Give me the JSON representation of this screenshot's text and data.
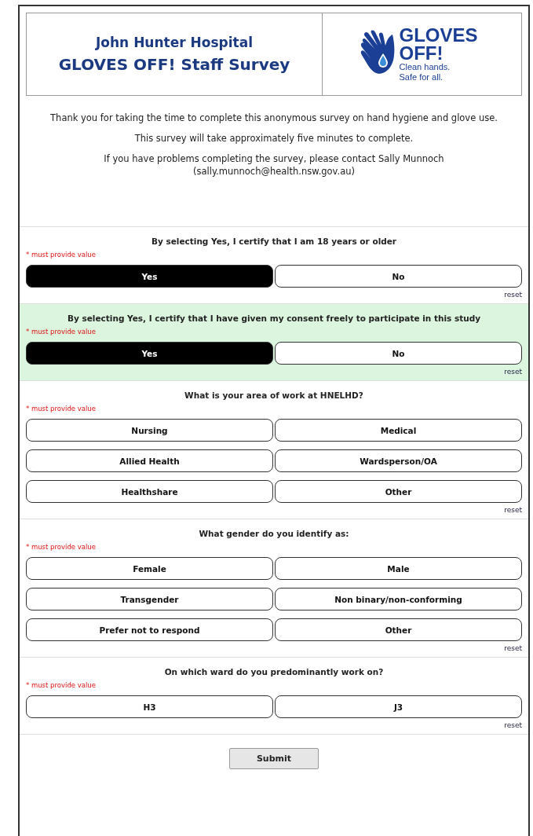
{
  "header": {
    "hospital": "John Hunter Hospital",
    "title": "GLOVES OFF! Staff Survey",
    "logo": {
      "wordmark": "GLOVES OFF!",
      "tagline_1": "Clean hands.",
      "tagline_2": "Safe for all."
    }
  },
  "intro": [
    "Thank you for taking the time to complete this anonymous survey on hand hygiene and glove use.",
    "This survey will take approximately five minutes to complete.",
    "If you have problems completing the survey, please contact Sally Munnoch (sally.munnoch@health.nsw.gov.au)"
  ],
  "questions": [
    {
      "question": "By selecting Yes, I certify that I am 18 years or older",
      "required_note": "* must provide value",
      "highlighted": false,
      "options": [
        {
          "label": "Yes",
          "selected": true
        },
        {
          "label": "No",
          "selected": false
        }
      ],
      "reset": "reset"
    },
    {
      "question": "By selecting Yes, I certify that I have given my consent freely to participate in this study",
      "required_note": "* must provide value",
      "highlighted": true,
      "options": [
        {
          "label": "Yes",
          "selected": true
        },
        {
          "label": "No",
          "selected": false
        }
      ],
      "reset": "reset"
    },
    {
      "question": "What is your area of work at HNELHD?",
      "required_note": "* must provide value",
      "highlighted": false,
      "options": [
        {
          "label": "Nursing",
          "selected": false
        },
        {
          "label": "Medical",
          "selected": false
        },
        {
          "label": "Allied Health",
          "selected": false
        },
        {
          "label": "Wardsperson/OA",
          "selected": false
        },
        {
          "label": "Healthshare",
          "selected": false
        },
        {
          "label": "Other",
          "selected": false
        }
      ],
      "reset": "reset"
    },
    {
      "question": "What gender do you identify as:",
      "required_note": "* must provide value",
      "highlighted": false,
      "options": [
        {
          "label": "Female",
          "selected": false
        },
        {
          "label": "Male",
          "selected": false
        },
        {
          "label": "Transgender",
          "selected": false
        },
        {
          "label": "Non binary/non-conforming",
          "selected": false
        },
        {
          "label": "Prefer not to respond",
          "selected": false
        },
        {
          "label": "Other",
          "selected": false
        }
      ],
      "reset": "reset"
    },
    {
      "question": "On which ward do you predominantly work on?",
      "required_note": "* must provide value",
      "highlighted": false,
      "options": [
        {
          "label": "H3",
          "selected": false
        },
        {
          "label": "J3",
          "selected": false
        }
      ],
      "reset": "reset"
    }
  ],
  "submit": "Submit"
}
